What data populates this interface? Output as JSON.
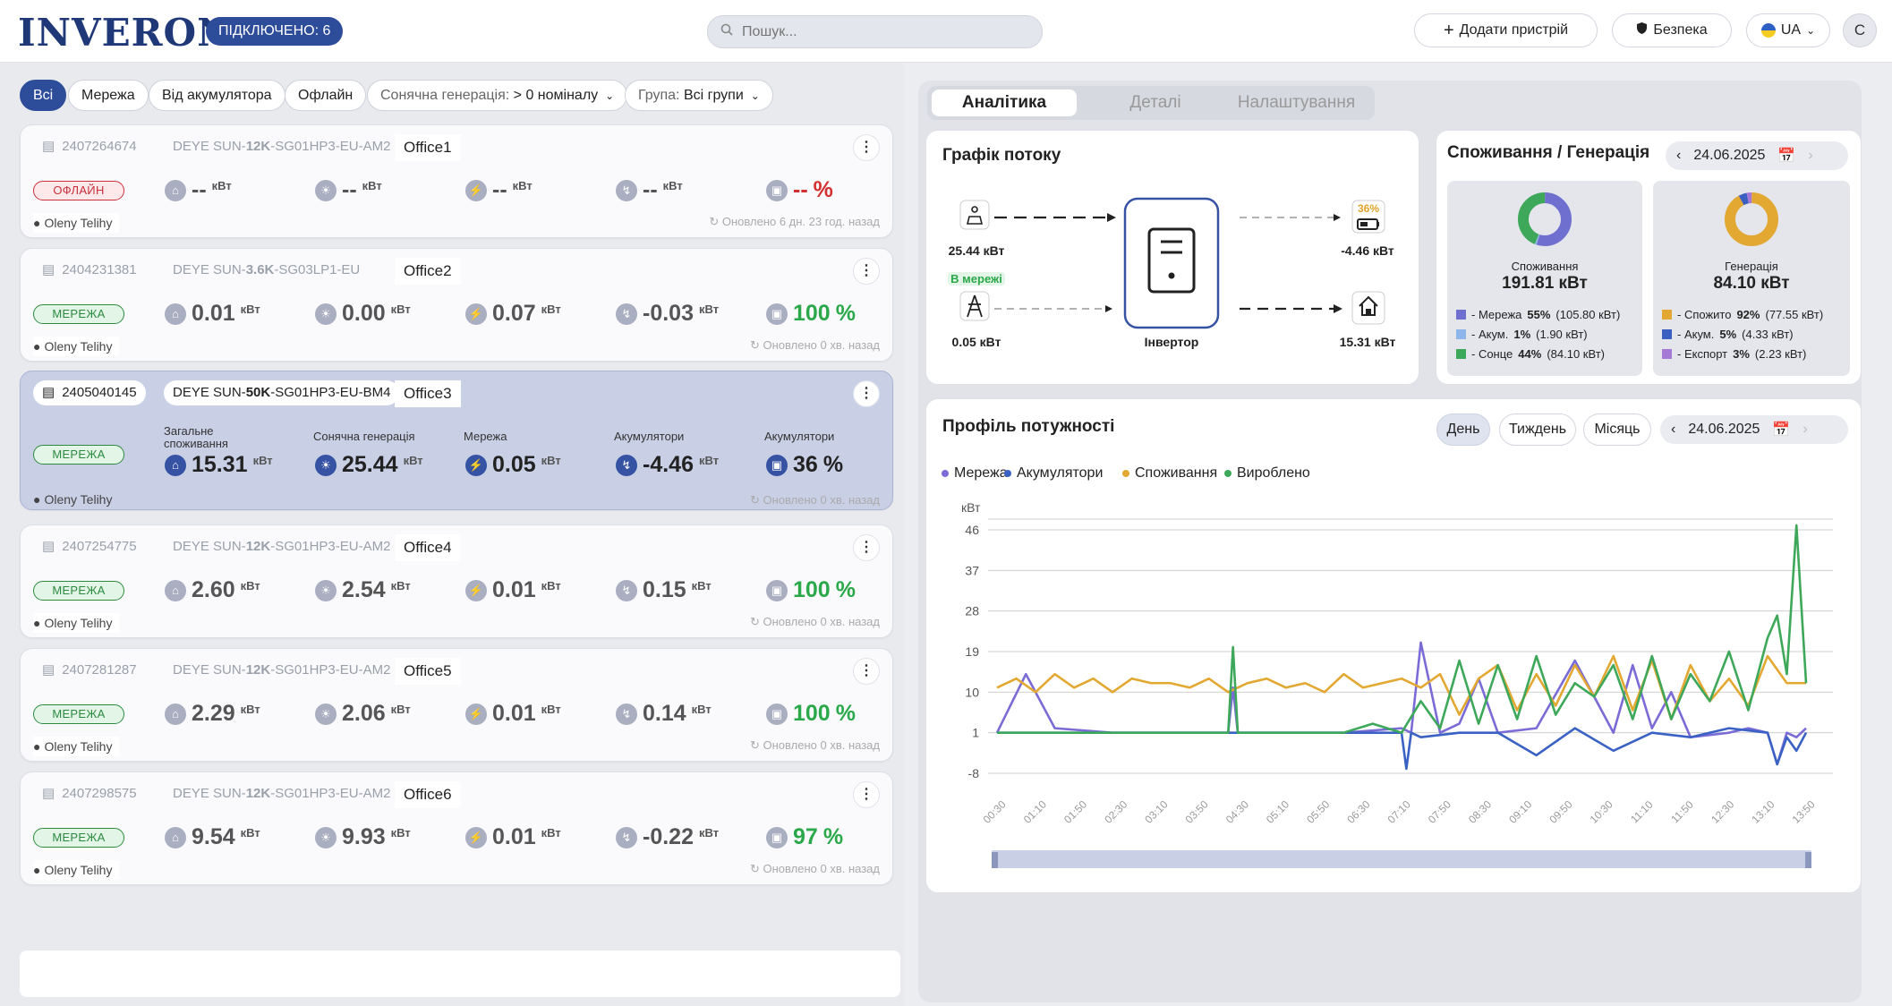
{
  "header": {
    "logo": "INVERON",
    "connected_badge": "ПІДКЛЮЧЕНО: 6",
    "search_placeholder": "Пошук...",
    "add_device_label": "Додати пристрій",
    "security_label": "Безпека",
    "language": "UA",
    "user_initial": "C"
  },
  "filters": {
    "all": "Всі",
    "grid": "Мережа",
    "battery": "Від акумулятора",
    "offline": "Офлайн",
    "solar_prefix": "Сонячна генерація:",
    "solar_value": "> 0 номіналу",
    "group_prefix": "Група:",
    "group_value": "Всі групи"
  },
  "metric_labels": {
    "consumption_l1": "Загальне",
    "consumption_l2": "споживання",
    "solar": "Сонячна генерація",
    "grid": "Мережа",
    "battery_power": "Акумулятори",
    "battery_soc": "Акумулятори"
  },
  "unit": "кВт",
  "devices": [
    {
      "serial": "2407264674",
      "model_pre": "DEYE SUN-",
      "model_bold": "12K",
      "model_post": "-SG01HP3-EU-AM2",
      "name": "Office1",
      "status": "ОФЛАЙН",
      "consumption": "--",
      "solar": "--",
      "grid": "--",
      "battery": "--",
      "soc": "--",
      "soc_unit": "%",
      "location": "Oleny Telihy",
      "updated": "Оновлено 6 дн. 23 год. назад"
    },
    {
      "serial": "2404231381",
      "model_pre": "DEYE SUN-",
      "model_bold": "3.6K",
      "model_post": "-SG03LP1-EU",
      "name": "Office2",
      "status": "МЕРЕЖА",
      "consumption": "0.01",
      "solar": "0.00",
      "grid": "0.07",
      "battery": "-0.03",
      "soc": "100",
      "soc_unit": "%",
      "location": "Oleny Telihy",
      "updated": "Оновлено 0 хв. назад"
    },
    {
      "serial": "2405040145",
      "model_pre": "DEYE SUN-",
      "model_bold": "50K",
      "model_post": "-SG01HP3-EU-BM4",
      "name": "Office3",
      "status": "МЕРЕЖА",
      "consumption": "15.31",
      "solar": "25.44",
      "grid": "0.05",
      "battery": "-4.46",
      "soc": "36",
      "soc_unit": "%",
      "location": "Oleny Telihy",
      "updated": "Оновлено 0 хв. назад"
    },
    {
      "serial": "2407254775",
      "model_pre": "DEYE SUN-",
      "model_bold": "12K",
      "model_post": "-SG01HP3-EU-AM2",
      "name": "Office4",
      "status": "МЕРЕЖА",
      "consumption": "2.60",
      "solar": "2.54",
      "grid": "0.01",
      "battery": "0.15",
      "soc": "100",
      "soc_unit": "%",
      "location": "Oleny Telihy",
      "updated": "Оновлено 0 хв. назад"
    },
    {
      "serial": "2407281287",
      "model_pre": "DEYE SUN-",
      "model_bold": "12K",
      "model_post": "-SG01HP3-EU-AM2",
      "name": "Office5",
      "status": "МЕРЕЖА",
      "consumption": "2.29",
      "solar": "2.06",
      "grid": "0.01",
      "battery": "0.14",
      "soc": "100",
      "soc_unit": "%",
      "location": "Oleny Telihy",
      "updated": "Оновлено 0 хв. назад"
    },
    {
      "serial": "2407298575",
      "model_pre": "DEYE SUN-",
      "model_bold": "12K",
      "model_post": "-SG01HP3-EU-AM2",
      "name": "Office6",
      "status": "МЕРЕЖА",
      "consumption": "9.54",
      "solar": "9.93",
      "grid": "0.01",
      "battery": "-0.22",
      "soc": "97",
      "soc_unit": "%",
      "location": "Oleny Telihy",
      "updated": "Оновлено 0 хв. назад"
    }
  ],
  "right_tabs": {
    "analytics": "Аналітика",
    "details": "Деталі",
    "settings": "Налаштування"
  },
  "flow": {
    "title": "Графік потоку",
    "solar_value": "25.44 кВт",
    "grid_badge": "В мережі",
    "grid_value": "0.05 кВт",
    "inverter_label": "Інвертор",
    "battery_pct": "36%",
    "battery_value": "-4.46 кВт",
    "home_value": "15.31 кВт"
  },
  "consgen": {
    "title": "Споживання / Генерація",
    "date": "24.06.2025",
    "consumption_label": "Споживання",
    "consumption_value": "191.81 кВт",
    "generation_label": "Генерація",
    "generation_value": "84.10 кВт",
    "cons_legend": [
      {
        "pre": "- Мережа ",
        "pct": "55%",
        "post": " (105.80 кВт)",
        "color": "#6f6fd0"
      },
      {
        "pre": "- Акум. ",
        "pct": "1%",
        "post": " (1.90 кВт)",
        "color": "#8fb6ea"
      },
      {
        "pre": "- Сонце ",
        "pct": "44%",
        "post": " (84.10 кВт)",
        "color": "#3ea85a"
      }
    ],
    "gen_legend": [
      {
        "pre": "- Спожито ",
        "pct": "92%",
        "post": " (77.55 кВт)",
        "color": "#e2a832"
      },
      {
        "pre": "- Акум. ",
        "pct": "5%",
        "post": " (4.33 кВт)",
        "color": "#3a5fc0"
      },
      {
        "pre": "- Експорт ",
        "pct": "3%",
        "post": " (2.23 кВт)",
        "color": "#a679d6"
      }
    ],
    "cons_shares": [
      55,
      1,
      44
    ],
    "gen_shares": [
      92,
      5,
      3
    ]
  },
  "profile": {
    "title": "Профіль потужності",
    "periods": {
      "day": "День",
      "week": "Тиждень",
      "month": "Місяць"
    },
    "date": "24.06.2025"
  },
  "chart_data": {
    "type": "line",
    "ylabel": "кВт",
    "ylim": [
      -8,
      46
    ],
    "yticks": [
      46,
      37,
      28,
      19,
      10,
      1,
      -8
    ],
    "xticks": [
      "00:30",
      "01:10",
      "01:50",
      "02:30",
      "03:10",
      "03:50",
      "04:30",
      "05:10",
      "05:50",
      "06:30",
      "07:10",
      "07:50",
      "08:30",
      "09:10",
      "09:50",
      "10:30",
      "11:10",
      "11:50",
      "12:30",
      "13:10",
      "13:50"
    ],
    "xlim": [
      0,
      840
    ],
    "series": [
      {
        "name": "Мережа",
        "color": "#7a6bd6",
        "x": [
          0,
          30,
          60,
          120,
          200,
          240,
          245,
          250,
          260,
          300,
          360,
          420,
          430,
          440,
          460,
          480,
          500,
          520,
          560,
          600,
          640,
          660,
          680,
          700,
          720,
          760,
          780,
          800,
          810,
          820,
          830,
          840
        ],
        "y": [
          1,
          14,
          2,
          1,
          1,
          1,
          11,
          1,
          1,
          1,
          1,
          2,
          1,
          21,
          1,
          3,
          13,
          1,
          2,
          17,
          1,
          16,
          2,
          10,
          0,
          1,
          2,
          1,
          -6,
          1,
          0,
          2
        ]
      },
      {
        "name": "Акумулятори",
        "color": "#3a62c4",
        "x": [
          0,
          60,
          120,
          180,
          240,
          300,
          360,
          420,
          425,
          430,
          440,
          480,
          520,
          560,
          600,
          640,
          680,
          720,
          760,
          800,
          810,
          820,
          830,
          840
        ],
        "y": [
          1,
          1,
          1,
          1,
          1,
          1,
          1,
          1,
          -7,
          1,
          0,
          1,
          1,
          -4,
          2,
          -3,
          1,
          0,
          2,
          1,
          -6,
          0,
          -3,
          1
        ]
      },
      {
        "name": "Споживання",
        "color": "#e2a832",
        "x": [
          0,
          20,
          40,
          60,
          80,
          100,
          120,
          140,
          160,
          180,
          200,
          220,
          240,
          260,
          280,
          300,
          320,
          340,
          360,
          380,
          400,
          420,
          440,
          460,
          480,
          500,
          520,
          540,
          560,
          580,
          600,
          620,
          640,
          660,
          680,
          700,
          720,
          740,
          760,
          780,
          800,
          820,
          840
        ],
        "y": [
          11,
          13,
          10,
          14,
          11,
          13,
          10,
          13,
          12,
          12,
          11,
          13,
          10,
          12,
          13,
          11,
          12,
          10,
          14,
          11,
          12,
          13,
          11,
          14,
          5,
          13,
          16,
          6,
          14,
          7,
          16,
          9,
          18,
          6,
          17,
          4,
          16,
          8,
          13,
          7,
          18,
          12,
          12
        ]
      },
      {
        "name": "Вироблено",
        "color": "#3ea85a",
        "x": [
          0,
          60,
          120,
          180,
          240,
          245,
          250,
          255,
          260,
          300,
          360,
          390,
          420,
          440,
          460,
          480,
          500,
          520,
          540,
          560,
          580,
          600,
          620,
          640,
          660,
          680,
          700,
          720,
          740,
          760,
          780,
          800,
          810,
          820,
          830,
          840
        ],
        "y": [
          1,
          1,
          1,
          1,
          1,
          20,
          1,
          1,
          1,
          1,
          1,
          3,
          1,
          8,
          2,
          17,
          3,
          16,
          4,
          18,
          5,
          12,
          9,
          16,
          4,
          18,
          4,
          14,
          8,
          19,
          6,
          22,
          27,
          14,
          47,
          12
        ]
      }
    ]
  }
}
